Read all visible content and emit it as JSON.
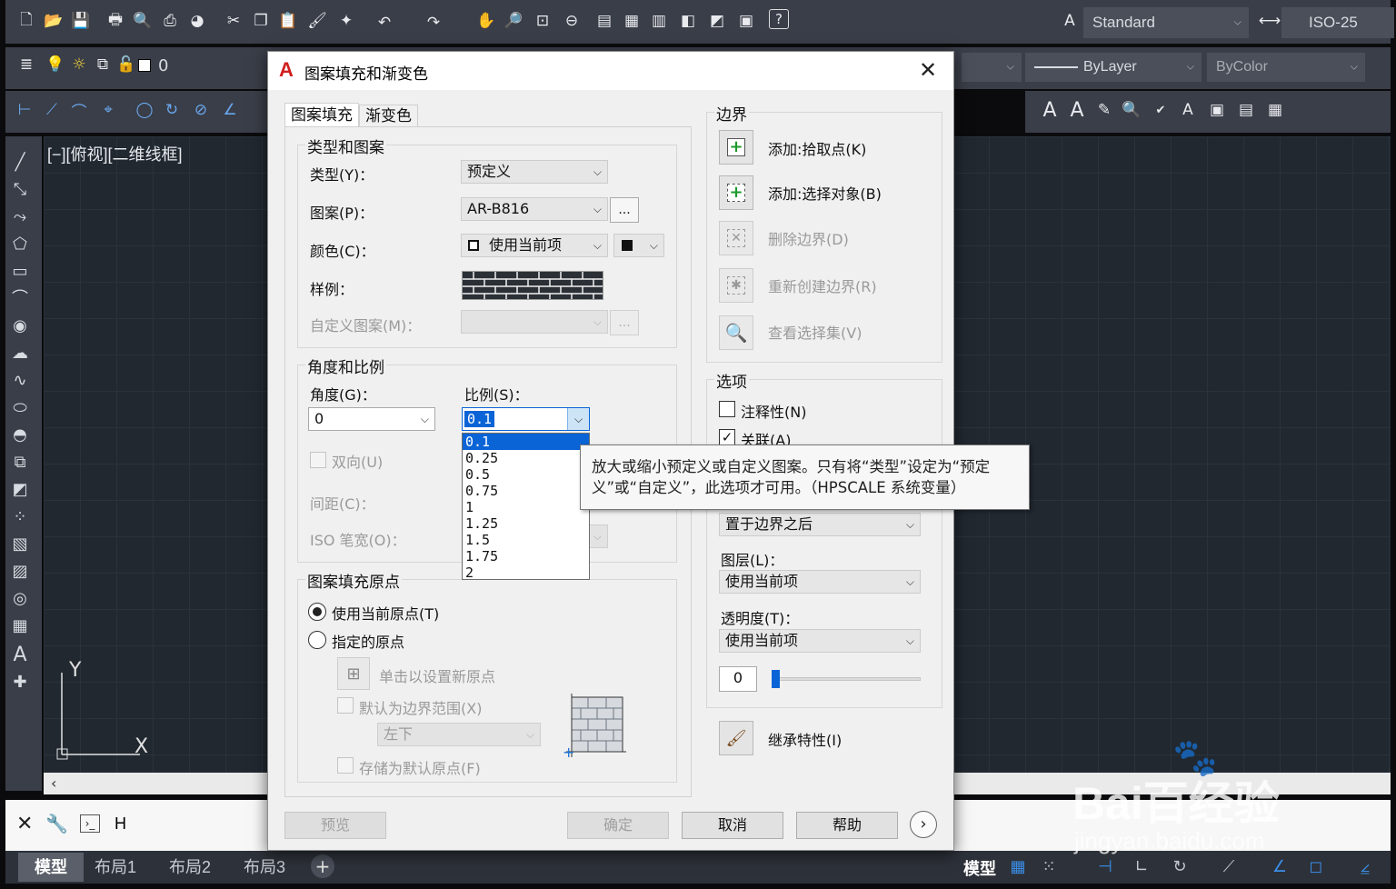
{
  "toolbar": {
    "text_style": "Standard",
    "dim_style": "ISO-25",
    "layer_value": "0",
    "linetype": "ByLayer",
    "plotstyle": "ByColor"
  },
  "viewport_label": "[−][俯视][二维线框]",
  "dialog": {
    "title": "图案填充和渐变色",
    "tabs": [
      "图案填充",
      "渐变色"
    ],
    "type_group": {
      "title": "类型和图案",
      "type_label": "类型(Y)：",
      "type_value": "预定义",
      "pattern_label": "图案(P)：",
      "pattern_value": "AR-B816",
      "pattern_btn": "...",
      "color_label": "颜色(C)：",
      "color_value": "使用当前项",
      "swatch_label": "样例：",
      "custom_label": "自定义图案(M)：",
      "custom_btn": "..."
    },
    "angle_group": {
      "title": "角度和比例",
      "angle_label": "角度(G)：",
      "angle_value": "0",
      "scale_label": "比例(S)：",
      "scale_value": "0.1",
      "double_label": "双向(U)",
      "spacing_label": "间距(C)：",
      "iso_label": "ISO 笔宽(O)："
    },
    "scale_options": [
      "0.1",
      "0.25",
      "0.5",
      "0.75",
      "1",
      "1.25",
      "1.5",
      "1.75",
      "2"
    ],
    "origin_group": {
      "title": "图案填充原点",
      "use_current": "使用当前原点(T)",
      "specified": "指定的原点",
      "click_set": "单击以设置新原点",
      "default_extent": "默认为边界范围(X)",
      "extent_value": "左下",
      "store_default": "存储为默认原点(F)"
    },
    "boundary_group": {
      "title": "边界",
      "add_pick": "添加:拾取点(K)",
      "add_select": "添加:选择对象(B)",
      "remove": "删除边界(D)",
      "recreate": "重新创建边界(R)",
      "view_set": "查看选择集(V)"
    },
    "options_group": {
      "title": "选项",
      "annotative": "注释性(N)",
      "associative": "关联(A)",
      "draw_order_value": "置于边界之后",
      "layer_label": "图层(L)：",
      "layer_value": "使用当前项",
      "transparency_label": "透明度(T)：",
      "transparency_value": "使用当前项",
      "transparency_amount": "0"
    },
    "inherit": "继承特性(I)",
    "buttons": {
      "preview": "预览",
      "ok": "确定",
      "cancel": "取消",
      "help": "帮助"
    }
  },
  "tooltip": "放大或缩小预定义或自定义图案。只有将“类型”设定为“预定义”或“自定义”，此选项才可用。（HPSCALE 系统变量）",
  "command_line": "H",
  "layout_tabs": [
    "模型",
    "布局1",
    "布局2",
    "布局3"
  ],
  "status_model": "模型",
  "watermark": {
    "brand": "Bai百经验",
    "url": "jingyan.baidu.com"
  },
  "colors": {
    "accent": "#0a64d6",
    "autocad_red": "#d11f1f",
    "canvas_bg": "#212830",
    "dialog_bg": "#f0f0f0"
  }
}
